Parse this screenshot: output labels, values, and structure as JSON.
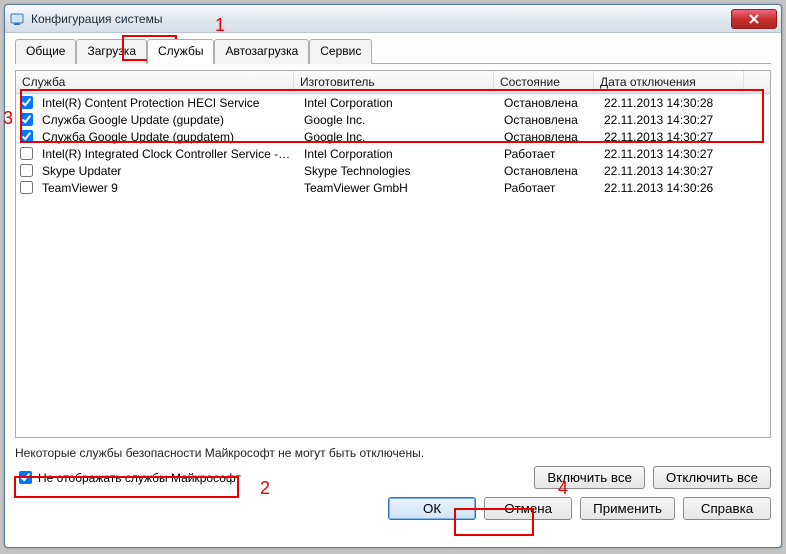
{
  "window": {
    "title": "Конфигурация системы"
  },
  "tabs": {
    "items": [
      {
        "label": "Общие"
      },
      {
        "label": "Загрузка"
      },
      {
        "label": "Службы"
      },
      {
        "label": "Автозагрузка"
      },
      {
        "label": "Сервис"
      }
    ]
  },
  "columns": {
    "service": "Служба",
    "mfr": "Изготовитель",
    "state": "Состояние",
    "date": "Дата отключения"
  },
  "services": [
    {
      "checked": true,
      "name": "Intel(R) Content Protection HECI Service",
      "mfr": "Intel Corporation",
      "state": "Остановлена",
      "date": "22.11.2013 14:30:28"
    },
    {
      "checked": true,
      "name": "Служба Google Update (gupdate)",
      "mfr": "Google Inc.",
      "state": "Остановлена",
      "date": "22.11.2013 14:30:27"
    },
    {
      "checked": true,
      "name": "Служба Google Update (gupdatem)",
      "mfr": "Google Inc.",
      "state": "Остановлена",
      "date": "22.11.2013 14:30:27"
    },
    {
      "checked": false,
      "name": "Intel(R) Integrated Clock Controller Service - Int...",
      "mfr": "Intel Corporation",
      "state": "Работает",
      "date": "22.11.2013 14:30:27"
    },
    {
      "checked": false,
      "name": "Skype Updater",
      "mfr": "Skype Technologies",
      "state": "Остановлена",
      "date": "22.11.2013 14:30:27"
    },
    {
      "checked": false,
      "name": "TeamViewer 9",
      "mfr": "TeamViewer GmbH",
      "state": "Работает",
      "date": "22.11.2013 14:30:26"
    }
  ],
  "note": "Некоторые службы безопасности Майкрософт не могут быть отключены.",
  "hide_ms": {
    "label": "Не отображать службы Майкрософт",
    "checked": true
  },
  "buttons": {
    "enable_all": "Включить все",
    "disable_all": "Отключить все",
    "ok": "ОК",
    "cancel": "Отмена",
    "apply": "Применить",
    "help": "Справка"
  },
  "annotations": {
    "n1": "1",
    "n2": "2",
    "n3": "3",
    "n4": "4"
  }
}
